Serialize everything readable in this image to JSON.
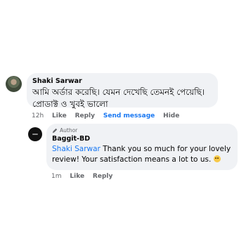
{
  "comment": {
    "author": "Shaki Sarwar",
    "text": "আমি অর্ডার করেছি। যেমন দেখেছি তেমনই পেয়েছি। প্রোডাক্ট ও খুবই ভালো",
    "time": "12h",
    "like_label": "Like",
    "reply_label": "Reply",
    "send_message_label": "Send message",
    "hide_label": "Hide"
  },
  "reply": {
    "badge": "Author",
    "author": "Baggit-BD",
    "mention": "Shaki Sarwar",
    "text": " Thank you so much for your lovely review! Your satisfaction means a lot to us. ",
    "emoji": "smiling-face-icon",
    "time": "1m",
    "like_label": "Like",
    "reply_label": "Reply"
  },
  "colors": {
    "bubble": "#f0f2f5",
    "link": "#1877f2",
    "meta": "#65676b"
  }
}
